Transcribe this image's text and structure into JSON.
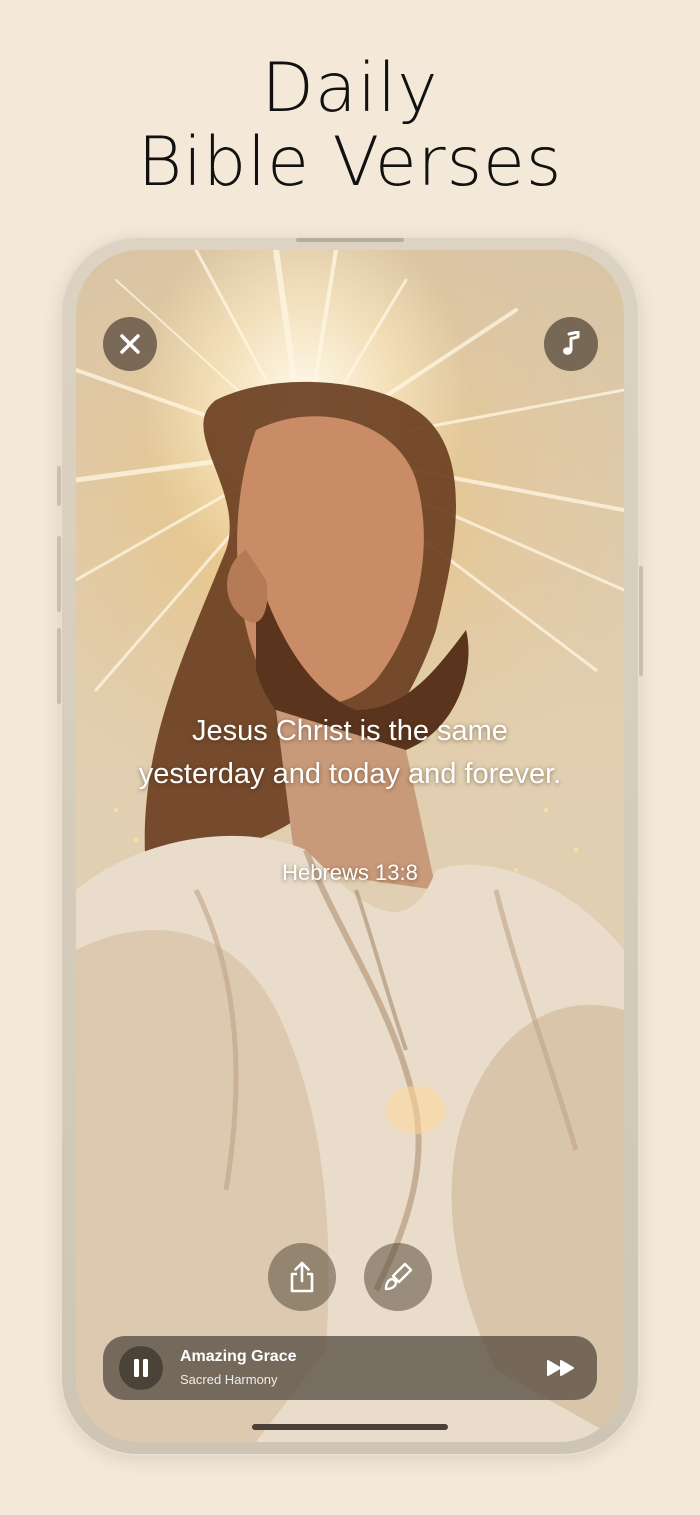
{
  "headline": {
    "line1": "Daily",
    "line2": "Bible Verses"
  },
  "screen": {
    "verse_text": "Jesus Christ is the same yesterday and today and forever.",
    "verse_reference": "Hebrews 13:8",
    "top_controls": {
      "close_icon": "close-icon",
      "music_icon": "music-note-icon"
    },
    "actions": {
      "share_icon": "share-icon",
      "brush_icon": "brush-icon"
    },
    "player": {
      "track_title": "Amazing Grace",
      "track_artist": "Sacred Harmony",
      "state": "playing",
      "pause_icon": "pause-icon",
      "next_icon": "fast-forward-icon"
    }
  },
  "colors": {
    "background": "#f4e9d8",
    "text": "#111111",
    "button_overlay": "#504437"
  }
}
